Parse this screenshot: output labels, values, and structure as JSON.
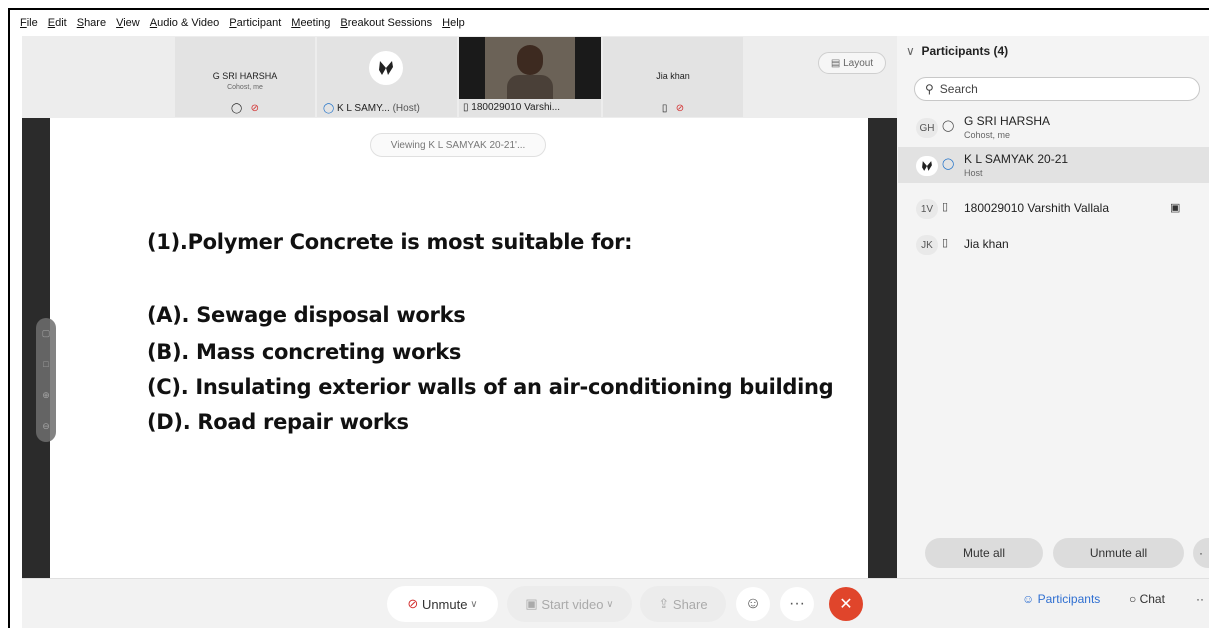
{
  "menu": [
    "File",
    "Edit",
    "Share",
    "View",
    "Audio & Video",
    "Participant",
    "Meeting",
    "Breakout Sessions",
    "Help"
  ],
  "tiles": {
    "harsha": {
      "name": "G SRI HARSHA",
      "sub": "Cohost, me"
    },
    "samyak": {
      "name": "K L SAMY...",
      "role": "(Host)"
    },
    "varshith": {
      "name": "180029010 Varshi..."
    },
    "jia": {
      "name": "Jia khan"
    }
  },
  "layout_label": "Layout",
  "viewing": "Viewing K L SAMYAK 20-21'...",
  "slide": {
    "question": "(1).Polymer Concrete is most suitable for:",
    "options": [
      "(A). Sewage disposal works",
      "(B). Mass concreting works",
      "(C). Insulating exterior walls of an air-conditioning building",
      "(D). Road repair works"
    ]
  },
  "participants": {
    "header": "Participants (4)",
    "search_placeholder": "Search",
    "list": [
      {
        "initials": "GH",
        "name": "G SRI HARSHA",
        "sub": "Cohost, me"
      },
      {
        "initials": "",
        "name": "K L SAMYAK 20-21",
        "sub": "Host"
      },
      {
        "initials": "1V",
        "name": "180029010 Varshith Vallala",
        "sub": ""
      },
      {
        "initials": "JK",
        "name": "Jia khan",
        "sub": ""
      }
    ],
    "mute_all": "Mute all",
    "unmute_all": "Unmute all"
  },
  "controls": {
    "unmute": "Unmute",
    "start_video": "Start video",
    "share": "Share",
    "participants_tab": "Participants",
    "chat_tab": "Chat"
  },
  "colors": {
    "end_call": "#e0452b",
    "accent": "#2f6fd1"
  },
  "icons": [
    "headset-icon",
    "mic-muted-icon",
    "phone-icon",
    "layout-icon",
    "search-icon",
    "video-icon",
    "emoji-icon",
    "more-icon",
    "close-icon",
    "participants-icon",
    "chat-icon"
  ]
}
